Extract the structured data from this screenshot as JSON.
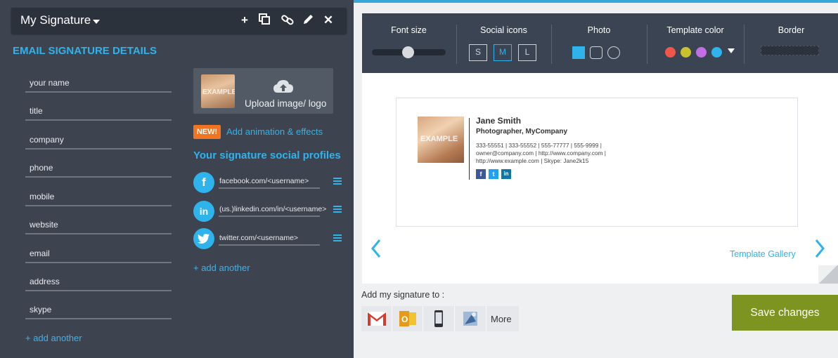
{
  "signature_bar": {
    "title": "My Signature"
  },
  "details": {
    "section_title": "EMAIL SIGNATURE DETAILS",
    "fields": [
      "your name",
      "title",
      "company",
      "phone",
      "mobile",
      "website",
      "email",
      "address",
      "skype"
    ],
    "add_another": "+ add another"
  },
  "upload": {
    "label": "Upload image/ logo",
    "thumb_text": "EXAMPLE"
  },
  "animation": {
    "badge": "NEW!",
    "label": "Add animation & effects"
  },
  "social": {
    "title": "Your signature social profiles",
    "profiles": [
      {
        "icon": "facebook-icon",
        "glyph": "f",
        "placeholder": "facebook.com/<username>"
      },
      {
        "icon": "linkedin-icon",
        "glyph": "in",
        "placeholder": "(us.)linkedin.com/in/<username>"
      },
      {
        "icon": "twitter-icon",
        "glyph": "t",
        "placeholder": "twitter.com/<username>"
      }
    ],
    "add_another": "+ add another"
  },
  "toolbar": {
    "font_size": {
      "label": "Font size",
      "value": 0.5
    },
    "social_icons": {
      "label": "Social icons",
      "sizes": [
        "S",
        "M",
        "L"
      ],
      "selected": "M"
    },
    "photo": {
      "label": "Photo",
      "shapes": [
        "square-filled",
        "rounded-square",
        "circle"
      ],
      "selected": "square-filled"
    },
    "template_color": {
      "label": "Template color",
      "colors": [
        "#f0564a",
        "#c9c22d",
        "#c46ee6",
        "#2fb3ec"
      ]
    },
    "border": {
      "label": "Border"
    }
  },
  "preview": {
    "photo_text": "EXAMPLE",
    "name": "Jane Smith",
    "job": "Photographer, MyCompany",
    "lines": [
      "333-55551 | 333-55552 | 555-77777 | 555-9999 |",
      "owner@company.com | http://www.company.com |",
      "http://www.example.com | Skype: Jane2k15"
    ],
    "social": [
      {
        "icon": "facebook-icon",
        "glyph": "f",
        "color": "#3b5998"
      },
      {
        "icon": "twitter-icon",
        "glyph": "t",
        "color": "#1da1f2"
      },
      {
        "icon": "linkedin-icon",
        "glyph": "in",
        "color": "#0e76a8"
      }
    ]
  },
  "template_gallery": "Template Gallery",
  "add_to": {
    "label": "Add my signature to :",
    "more": "More"
  },
  "save": "Save changes",
  "colors": {
    "accent": "#2fb3ec",
    "save": "#7e9420",
    "panel": "#3d4450"
  }
}
